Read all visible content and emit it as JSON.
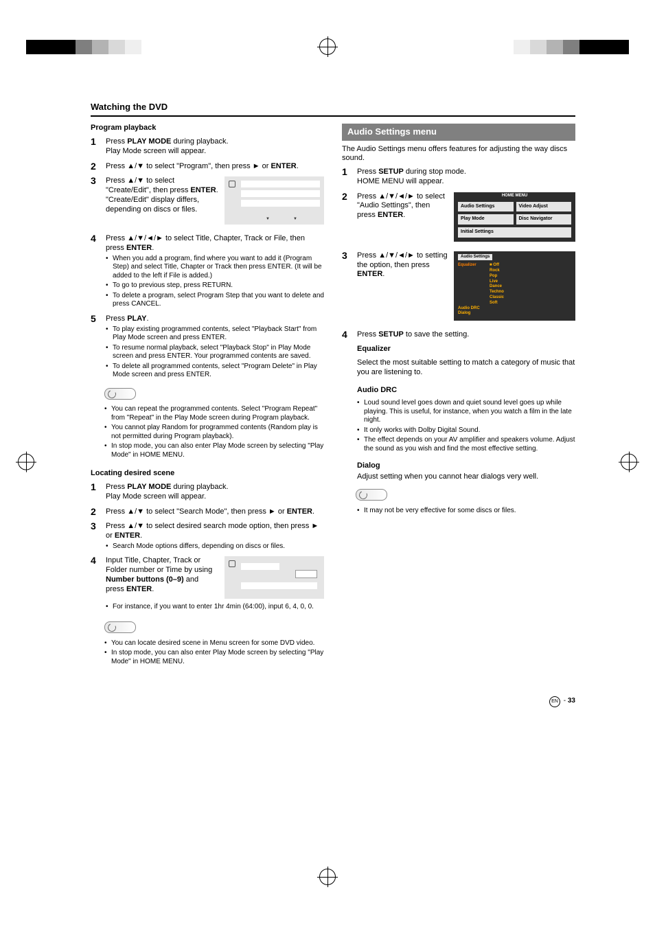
{
  "page": {
    "section_title": "Watching the DVD",
    "page_number_prefix": "EN",
    "page_number": "33"
  },
  "left": {
    "program_playback": {
      "heading": "Program playback",
      "steps": [
        {
          "n": "1",
          "body_a": "Press ",
          "bold_a": "PLAY MODE",
          "body_b": " during playback.",
          "sub": "Play Mode screen will appear."
        },
        {
          "n": "2",
          "body_a": "Press ",
          "arrows": "▲/▼",
          "body_b": " to select \"Program\", then press ",
          "arrow2": "►",
          "body_c": " or ",
          "bold_a": "ENTER",
          "body_d": "."
        },
        {
          "n": "3",
          "body_a": "Press ",
          "arrows": "▲/▼",
          "body_b": " to select \"Create/Edit\", then press ",
          "bold_a": "ENTER",
          "body_c": ". \"Create/Edit\" display differs, depending on discs or files."
        },
        {
          "n": "4",
          "body_a": "Press ",
          "arrows": "▲/▼/◄/►",
          "body_b": " to select Title, Chapter, Track or File, then press ",
          "bold_a": "ENTER",
          "body_c": ".",
          "bullets": [
            "When you add a program, find where you want to add it (Program Step) and select Title, Chapter or Track then press ENTER. (It will be added to the left if File is added.)",
            "To go to previous step, press RETURN.",
            "To delete a program, select Program Step that you want to delete and press CANCEL."
          ]
        },
        {
          "n": "5",
          "body_a": "Press ",
          "bold_a": "PLAY",
          "body_b": ".",
          "bullets": [
            "To play existing programmed contents, select \"Playback Start\" from Play Mode screen and press ENTER.",
            "To resume normal playback, select \"Playback Stop\" in Play Mode screen and press ENTER. Your programmed contents are saved.",
            "To delete all programmed contents, select \"Program Delete\" in Play Mode screen and press ENTER."
          ]
        }
      ],
      "notes": [
        "You can repeat the programmed contents. Select \"Program Repeat\" from \"Repeat\" in the Play Mode screen during Program playback.",
        "You cannot play Random for programmed contents (Random play is not permitted during Program playback).",
        "In stop mode, you can also enter Play Mode screen by selecting \"Play Mode\" in HOME MENU."
      ]
    },
    "locating": {
      "heading": "Locating desired scene",
      "steps": [
        {
          "n": "1",
          "body_a": "Press ",
          "bold_a": "PLAY MODE",
          "body_b": " during playback.",
          "sub": "Play Mode screen will appear."
        },
        {
          "n": "2",
          "body_a": "Press ",
          "arrows": "▲/▼",
          "body_b": " to select \"Search Mode\", then press ",
          "arrow2": "►",
          "body_c": " or ",
          "bold_a": "ENTER",
          "body_d": "."
        },
        {
          "n": "3",
          "body_a": "Press ",
          "arrows": "▲/▼",
          "body_b": " to select desired search mode option, then press ",
          "arrow2": "►",
          "body_c": " or ",
          "bold_a": "ENTER",
          "body_d": ".",
          "bullets": [
            "Search Mode options differs, depending on discs or files."
          ]
        },
        {
          "n": "4",
          "body_a": "Input Title, Chapter, Track or Folder number or Time by using ",
          "bold_a": "Number buttons (0–9)",
          "body_b": " and press ",
          "bold_b": "ENTER",
          "body_c": ".",
          "bullets": [
            "For instance, if you want to enter 1hr 4min (64:00), input 6, 4, 0, 0."
          ]
        }
      ],
      "notes": [
        "You can locate desired scene in Menu screen for some DVD video.",
        "In stop mode, you can also enter Play Mode screen by selecting \"Play Mode\" in HOME MENU."
      ]
    }
  },
  "right": {
    "title": "Audio Settings menu",
    "intro": "The Audio Settings menu offers features for adjusting the way discs sound.",
    "steps": [
      {
        "n": "1",
        "body_a": "Press ",
        "bold_a": "SETUP",
        "body_b": " during stop mode.",
        "sub": "HOME MENU will appear."
      },
      {
        "n": "2",
        "body_a": "Press ",
        "arrows": "▲/▼/◄/►",
        "body_b": " to select \"Audio Settings\", then press ",
        "bold_a": "ENTER",
        "body_c": "."
      },
      {
        "n": "3",
        "body_a": "Press ",
        "arrows": "▲/▼/◄/►",
        "body_b": " to setting the option, then press ",
        "bold_a": "ENTER",
        "body_c": "."
      },
      {
        "n": "4",
        "body_a": "Press ",
        "bold_a": "SETUP",
        "body_b": " to save the setting."
      }
    ],
    "home_menu": {
      "title": "HOME MENU",
      "audio_settings": "Audio Settings",
      "video_adjust": "Video Adjust",
      "play_mode": "Play Mode",
      "disc_navigator": "Disc Navigator",
      "initial_settings": "Initial Settings"
    },
    "audio_panel": {
      "title": "Audio Settings",
      "labels": {
        "equalizer": "Equalizer",
        "audio_drc": "Audio DRC",
        "dialog": "Dialog"
      },
      "values": [
        "Off",
        "Rock",
        "Pop",
        "Live",
        "Dance",
        "Techno",
        "Classic",
        "Soft"
      ]
    },
    "equalizer": {
      "heading": "Equalizer",
      "body": "Select the most suitable setting to match a category of music that you are listening to."
    },
    "audio_drc": {
      "heading": "Audio DRC",
      "bullets": [
        "Loud sound level goes down and quiet sound level goes up while playing. This is useful, for instance, when you watch a film in the late night.",
        "It only works with Dolby Digital Sound.",
        "The effect depends on your AV amplifier and speakers volume. Adjust the sound as you wish and find the most effective setting."
      ]
    },
    "dialog": {
      "heading": "Dialog",
      "body": "Adjust setting when you cannot hear dialogs very well.",
      "note": "It may not be very effective for some discs or files."
    }
  }
}
